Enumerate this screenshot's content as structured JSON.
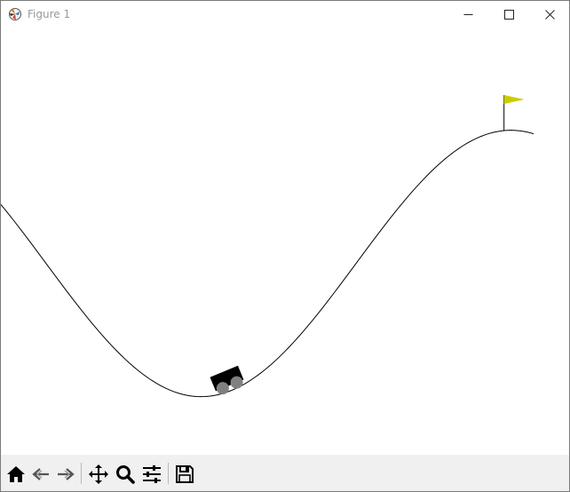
{
  "window": {
    "title": "Figure 1",
    "app_icon": "matplotlib-figure-icon",
    "controls": [
      "minimize-icon",
      "maximize-icon",
      "close-icon"
    ]
  },
  "scene": {
    "environment": "mountain-car",
    "track_color": "#000000",
    "car_color": "#000000",
    "wheel_color": "#808080",
    "flag_color": "#cccc00",
    "flagpole_color": "#000000"
  },
  "toolbar": {
    "buttons": [
      {
        "name": "home",
        "icon": "home-icon"
      },
      {
        "name": "back",
        "icon": "back-arrow-icon"
      },
      {
        "name": "forward",
        "icon": "forward-arrow-icon"
      },
      {
        "name": "pan",
        "icon": "pan-move-icon"
      },
      {
        "name": "zoom",
        "icon": "zoom-magnifier-icon"
      },
      {
        "name": "configure-subplots",
        "icon": "sliders-icon"
      },
      {
        "name": "save",
        "icon": "save-floppy-icon"
      }
    ]
  }
}
